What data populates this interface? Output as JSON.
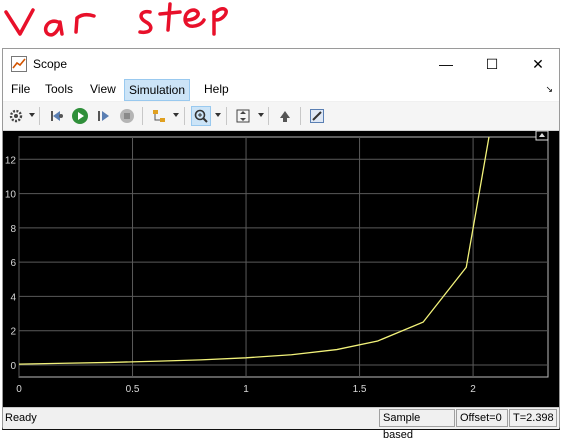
{
  "annotation": {
    "text": "Var Step",
    "color": "#e8102a"
  },
  "window": {
    "title": "Scope",
    "controls": {
      "minimize": "—",
      "maximize": "☐",
      "close": "✕"
    }
  },
  "menu": {
    "items": [
      {
        "label": "File",
        "key": "file"
      },
      {
        "label": "Tools",
        "key": "tools"
      },
      {
        "label": "View",
        "key": "view"
      },
      {
        "label": "Simulation",
        "key": "simulation",
        "active": true
      },
      {
        "label": "Help",
        "key": "help"
      }
    ],
    "corner_icon": "arrow-corner-icon"
  },
  "toolbar": {
    "icons": [
      "gear-icon",
      "step-back-icon",
      "run-icon",
      "step-forward-icon",
      "stop-icon",
      "signal-selector-icon",
      "zoom-icon",
      "autoscale-icon",
      "highlight-icon",
      "properties-icon"
    ]
  },
  "status": {
    "ready": "Ready",
    "mode": "Sample based",
    "offset": "Offset=0",
    "time": "T=2.398"
  },
  "chart_data": {
    "type": "line",
    "title": "",
    "xlabel": "",
    "ylabel": "",
    "xlim": [
      0,
      2.33
    ],
    "ylim": [
      -0.7,
      13.3
    ],
    "x_ticks": [
      0,
      0.5,
      1,
      1.5,
      2
    ],
    "x_tick_labels": [
      "0",
      "0.5",
      "1",
      "1.5",
      "2"
    ],
    "y_ticks": [
      0,
      2,
      4,
      6,
      8,
      10,
      12
    ],
    "y_tick_labels": [
      "0",
      "2",
      "4",
      "6",
      "8",
      "10",
      "12"
    ],
    "grid": true,
    "background": "#000000",
    "line_color": "#f2f27a",
    "series": [
      {
        "x": [
          0,
          0.2,
          0.4,
          0.6,
          0.8,
          1.0,
          1.2,
          1.4,
          1.58,
          1.78,
          1.97,
          2.07
        ],
        "y": [
          0.05,
          0.1,
          0.15,
          0.22,
          0.3,
          0.42,
          0.6,
          0.9,
          1.4,
          2.5,
          5.7,
          13.3
        ]
      }
    ]
  }
}
